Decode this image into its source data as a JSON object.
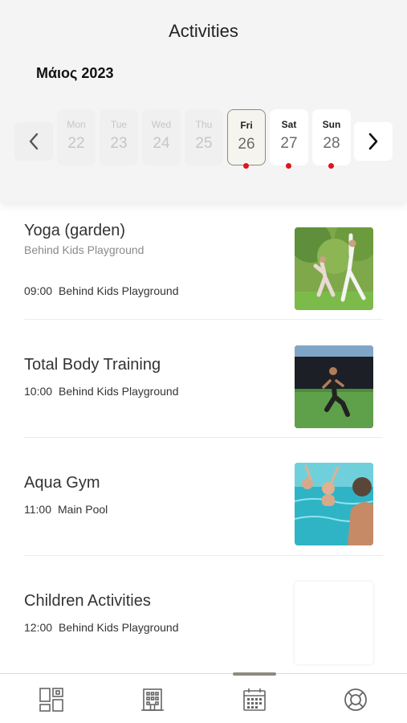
{
  "header": {
    "title": "Activities",
    "month": "Μάιος 2023"
  },
  "calendar": {
    "days": [
      {
        "name": "Mon",
        "num": "22",
        "state": "disabled",
        "has_events": false
      },
      {
        "name": "Tue",
        "num": "23",
        "state": "disabled",
        "has_events": false
      },
      {
        "name": "Wed",
        "num": "24",
        "state": "disabled",
        "has_events": false
      },
      {
        "name": "Thu",
        "num": "25",
        "state": "disabled",
        "has_events": false
      },
      {
        "name": "Fri",
        "num": "26",
        "state": "selected",
        "has_events": true
      },
      {
        "name": "Sat",
        "num": "27",
        "state": "enabled",
        "has_events": true
      },
      {
        "name": "Sun",
        "num": "28",
        "state": "enabled",
        "has_events": true
      }
    ],
    "event_dot_color": "#e0141e"
  },
  "activities": [
    {
      "title": "Yoga (garden)",
      "subtitle": "Behind Kids Playground",
      "time": "09:00",
      "place": "Behind Kids Playground",
      "image": "yoga-garden-photo"
    },
    {
      "title": "Total Body Training",
      "subtitle": "",
      "time": "10:00",
      "place": "Behind Kids Playground",
      "image": "training-photo"
    },
    {
      "title": "Aqua Gym",
      "subtitle": "",
      "time": "11:00",
      "place": "Main Pool",
      "image": "pool-photo"
    },
    {
      "title": "Children Activities",
      "subtitle": "",
      "time": "12:00",
      "place": "Behind Kids Playground",
      "image": ""
    }
  ],
  "tabbar": {
    "tabs": [
      {
        "icon": "dashboard-icon"
      },
      {
        "icon": "building-icon"
      },
      {
        "icon": "calendar-icon",
        "active": true
      },
      {
        "icon": "lifebuoy-icon"
      }
    ],
    "active_color": "#8f8a80"
  }
}
